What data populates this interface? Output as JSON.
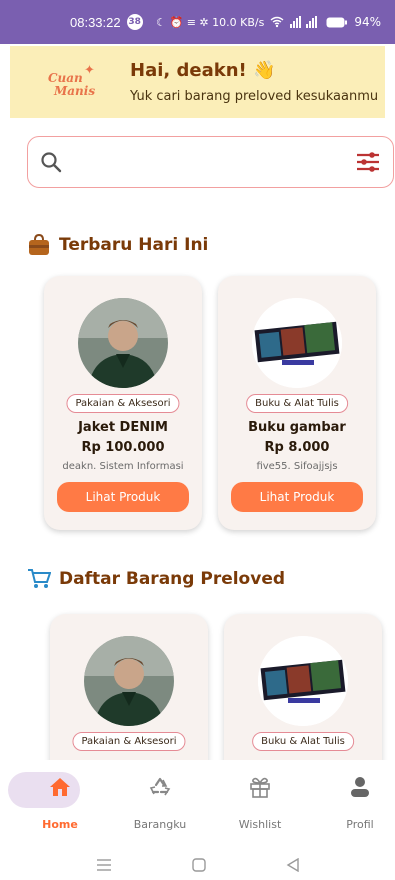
{
  "status": {
    "time": "08:33:22",
    "badge": "38",
    "icons_text": "☾ ⏰ ≡ ✲ 10.0 KB/s",
    "battery": "94%"
  },
  "banner": {
    "logo_line1": "Cuan",
    "logo_line2": "Manis",
    "greeting": "Hai, deakn! 👋",
    "subtitle": "Yuk cari barang preloved kesukaanmu"
  },
  "search": {
    "placeholder": ""
  },
  "sections": {
    "today": {
      "title": "Terbaru Hari Ini"
    },
    "preloved": {
      "title": "Daftar Barang Preloved"
    }
  },
  "today_cards": [
    {
      "category": "Pakaian & Aksesori",
      "name": "Jaket DENIM",
      "price": "Rp 100.000",
      "seller": "deakn. Sistem Informasi",
      "cta": "Lihat Produk"
    },
    {
      "category": "Buku & Alat Tulis",
      "name": "Buku gambar",
      "price": "Rp 8.000",
      "seller": "five55. Sifoajjsjs",
      "cta": "Lihat Produk"
    }
  ],
  "preloved_cards": [
    {
      "category": "Pakaian & Aksesori"
    },
    {
      "category": "Buku & Alat Tulis"
    }
  ],
  "nav": [
    {
      "label": "Home",
      "icon": "home-icon"
    },
    {
      "label": "Barangku",
      "icon": "recycle-icon"
    },
    {
      "label": "Wishlist",
      "icon": "gift-icon"
    },
    {
      "label": "Profil",
      "icon": "user-icon"
    }
  ],
  "colors": {
    "accent": "#ff7a45",
    "statusbar": "#7a5fb0",
    "banner": "#fbeeb8",
    "title": "#7a3a08"
  }
}
